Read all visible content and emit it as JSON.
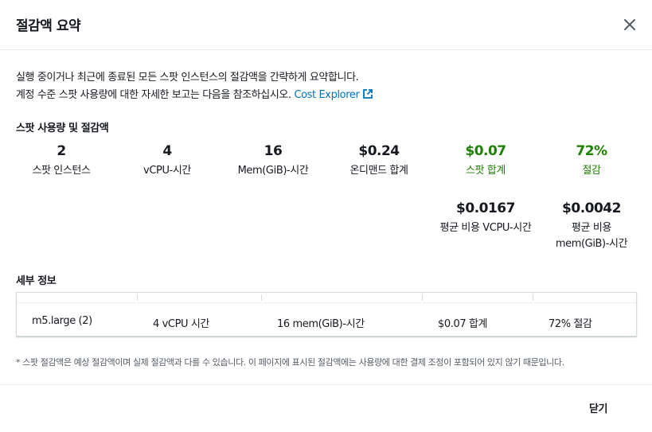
{
  "modal": {
    "title": "절감액 요약",
    "description_line1": "실행 중이거나 최근에 종료된 모든 스팟 인스턴스의 절감액을 간략하게 요약합니다.",
    "description_line2": "계정 수준 스팟 사용량에 대한 자세한 보고는 다음을 참조하십시오.",
    "link_text": "Cost Explorer",
    "close_icon": "close-icon",
    "external_icon": "external-link-icon"
  },
  "usage": {
    "section_title": "스팟 사용량 및 절감액",
    "stats": [
      {
        "value": "2",
        "label": "스팟 인스턴스"
      },
      {
        "value": "4",
        "label": "vCPU-시간"
      },
      {
        "value": "16",
        "label": "Mem(GiB)-시간"
      },
      {
        "value": "$0.24",
        "label": "온디맨드 합계"
      },
      {
        "value": "$0.07",
        "label": "스팟 합계"
      },
      {
        "value": "72%",
        "label": "절감"
      }
    ],
    "averages": [
      {
        "value": "$0.0167",
        "label": "평균 비용 VCPU-시간"
      },
      {
        "value": "$0.0042",
        "label": "평균 비용 mem(GiB)-시간"
      }
    ],
    "accent_color": "#1d8102"
  },
  "details": {
    "section_title": "세부 정보",
    "row": [
      "m5.large (2)",
      "4 vCPU 시간",
      "16 mem(GiB)-시간",
      "$0.07 합계",
      "72% 절감"
    ]
  },
  "footnote": "* 스팟 절감액은 예상 절감액이며 실제 절감액과 다를 수 있습니다. 이 페이지에 표시된 절감액에는 사용량에 대한 결제 조정이 포함되어 있지 않기 때문입니다.",
  "footer": {
    "close_label": "닫기"
  }
}
